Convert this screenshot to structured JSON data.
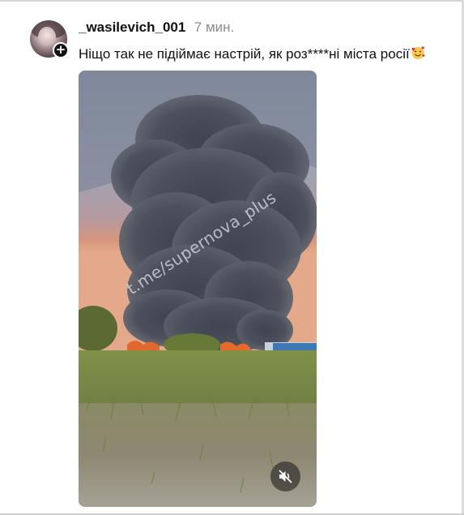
{
  "post": {
    "username": "_wasilevich_001",
    "time": "7 мин.",
    "message": "Ніщо так не підіймає настрій, як роз****ні міста росії",
    "message_emoji": "smiling-face-with-hearts-emoji",
    "follow_icon": "plus-icon",
    "follow_symbol": "+"
  },
  "video": {
    "watermark": "t.me/supernova_plus",
    "mute_icon": "speaker-muted-icon",
    "muted": true
  },
  "colors": {
    "username": "#111111",
    "time": "#8c8c8c",
    "badge": "#111111"
  }
}
